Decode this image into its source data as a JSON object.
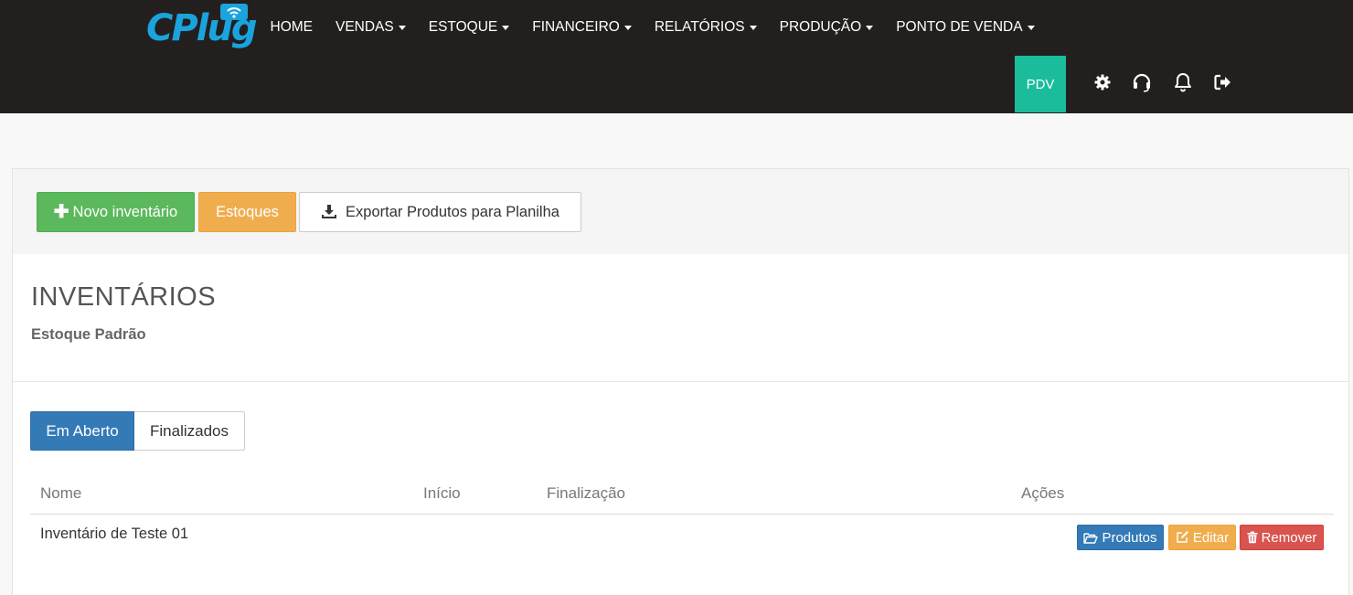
{
  "brand": {
    "logo_text": "CPlug",
    "logo_icon": "wifi-bubble-icon",
    "color": "#1aa3dc"
  },
  "nav": {
    "items": [
      {
        "label": "HOME",
        "dropdown": false
      },
      {
        "label": "VENDAS",
        "dropdown": true
      },
      {
        "label": "ESTOQUE",
        "dropdown": true
      },
      {
        "label": "FINANCEIRO",
        "dropdown": true
      },
      {
        "label": "RELATÓRIOS",
        "dropdown": true
      },
      {
        "label": "PRODUÇÃO",
        "dropdown": true
      },
      {
        "label": "PONTO DE VENDA",
        "dropdown": true
      }
    ],
    "pdv_label": "PDV",
    "icons": [
      "gear-icon",
      "headset-icon",
      "bell-icon",
      "logout-icon"
    ]
  },
  "toolbar": {
    "novo_label": "Novo inventário",
    "estoques_label": "Estoques",
    "export_label": "Exportar Produtos para Planilha"
  },
  "page": {
    "title": "INVENTÁRIOS",
    "subtitle": "Estoque Padrão"
  },
  "tabs": [
    {
      "label": "Em Aberto",
      "active": true
    },
    {
      "label": "Finalizados",
      "active": false
    }
  ],
  "table": {
    "headers": [
      "Nome",
      "Início",
      "Finalização",
      "Ações"
    ],
    "rows": [
      {
        "nome": "Inventário de Teste 01",
        "inicio": "",
        "finalizacao": ""
      }
    ],
    "actions": {
      "produtos_label": "Produtos",
      "editar_label": "Editar",
      "remover_label": "Remover"
    }
  },
  "colors": {
    "navbar_bg": "#231f1e",
    "pdv": "#1abc9c",
    "success": "#5cb85c",
    "warning": "#f0ad4e",
    "primary": "#337ab7",
    "danger": "#d9534f"
  }
}
